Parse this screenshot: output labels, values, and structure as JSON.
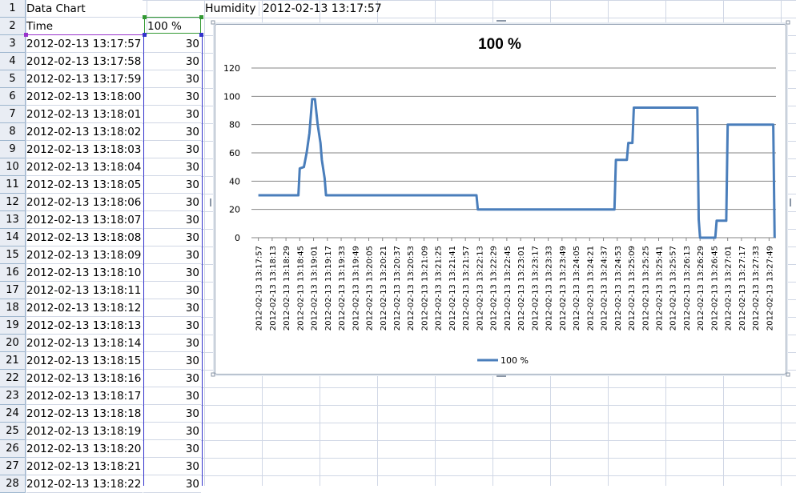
{
  "sheet": {
    "row_numbers": [
      "1",
      "2",
      "3",
      "4",
      "5",
      "6",
      "7",
      "8",
      "9",
      "10",
      "11",
      "12",
      "13",
      "14",
      "15",
      "16",
      "17",
      "18",
      "19",
      "20",
      "21",
      "22",
      "23",
      "24",
      "25",
      "26",
      "27",
      "28"
    ],
    "A1": "Data Chart",
    "C1": "Humidity",
    "D1": "2012-02-13 13:17:57",
    "A2": "Time",
    "B2": "100 %",
    "times": [
      "2012-02-13 13:17:57",
      "2012-02-13 13:17:58",
      "2012-02-13 13:17:59",
      "2012-02-13 13:18:00",
      "2012-02-13 13:18:01",
      "2012-02-13 13:18:02",
      "2012-02-13 13:18:03",
      "2012-02-13 13:18:04",
      "2012-02-13 13:18:05",
      "2012-02-13 13:18:06",
      "2012-02-13 13:18:07",
      "2012-02-13 13:18:08",
      "2012-02-13 13:18:09",
      "2012-02-13 13:18:10",
      "2012-02-13 13:18:11",
      "2012-02-13 13:18:12",
      "2012-02-13 13:18:13",
      "2012-02-13 13:18:14",
      "2012-02-13 13:18:15",
      "2012-02-13 13:18:16",
      "2012-02-13 13:18:17",
      "2012-02-13 13:18:18",
      "2012-02-13 13:18:19",
      "2012-02-13 13:18:20",
      "2012-02-13 13:18:21",
      "2012-02-13 13:18:22"
    ],
    "values": [
      "30",
      "30",
      "30",
      "30",
      "30",
      "30",
      "30",
      "30",
      "30",
      "30",
      "30",
      "30",
      "30",
      "30",
      "30",
      "30",
      "30",
      "30",
      "30",
      "30",
      "30",
      "30",
      "30",
      "30",
      "30",
      "30"
    ]
  },
  "colors": {
    "line": "#4a7ebb",
    "gridline": "#868686",
    "cell_grid": "#d0d7e5",
    "header_bg": "#e9edf4"
  },
  "chart_data": {
    "type": "line",
    "title": "100 %",
    "xlabel": "",
    "ylabel": "",
    "ylim": [
      0,
      120
    ],
    "yticks": [
      0,
      20,
      40,
      60,
      80,
      100,
      120
    ],
    "grid": true,
    "legend": "bottom",
    "categories": [
      "2012-02-13 13:17:57",
      "2012-02-13 13:18:13",
      "2012-02-13 13:18:29",
      "2012-02-13 13:18:45",
      "2012-02-13 13:19:01",
      "2012-02-13 13:19:17",
      "2012-02-13 13:19:33",
      "2012-02-13 13:19:49",
      "2012-02-13 13:20:05",
      "2012-02-13 13:20:21",
      "2012-02-13 13:20:37",
      "2012-02-13 13:20:53",
      "2012-02-13 13:21:09",
      "2012-02-13 13:21:25",
      "2012-02-13 13:21:41",
      "2012-02-13 13:21:57",
      "2012-02-13 13:22:13",
      "2012-02-13 13:22:29",
      "2012-02-13 13:22:45",
      "2012-02-13 13:23:01",
      "2012-02-13 13:23:17",
      "2012-02-13 13:23:33",
      "2012-02-13 13:23:49",
      "2012-02-13 13:24:05",
      "2012-02-13 13:24:21",
      "2012-02-13 13:24:37",
      "2012-02-13 13:24:53",
      "2012-02-13 13:25:09",
      "2012-02-13 13:25:25",
      "2012-02-13 13:25:41",
      "2012-02-13 13:25:57",
      "2012-02-13 13:26:13",
      "2012-02-13 13:26:29",
      "2012-02-13 13:26:45",
      "2012-02-13 13:27:01",
      "2012-02-13 13:27:17",
      "2012-02-13 13:27:33",
      "2012-02-13 13:27:49"
    ],
    "series": [
      {
        "name": "100 %",
        "points": [
          [
            0,
            30
          ],
          [
            2.9,
            30
          ],
          [
            3.0,
            49
          ],
          [
            3.3,
            50
          ],
          [
            3.5,
            60
          ],
          [
            3.7,
            74
          ],
          [
            3.9,
            98
          ],
          [
            4.1,
            98
          ],
          [
            4.3,
            80
          ],
          [
            4.5,
            67
          ],
          [
            4.6,
            55
          ],
          [
            4.8,
            42
          ],
          [
            4.9,
            30
          ],
          [
            15.8,
            30
          ],
          [
            15.9,
            20
          ],
          [
            25.8,
            20
          ],
          [
            25.9,
            55
          ],
          [
            26.7,
            55
          ],
          [
            26.8,
            67
          ],
          [
            27.1,
            67
          ],
          [
            27.2,
            92
          ],
          [
            31.8,
            92
          ],
          [
            31.9,
            13
          ],
          [
            32.0,
            0
          ],
          [
            33.1,
            0
          ],
          [
            33.2,
            12
          ],
          [
            33.9,
            12
          ],
          [
            34.0,
            80
          ],
          [
            37.3,
            80
          ],
          [
            37.4,
            0
          ]
        ]
      }
    ]
  }
}
